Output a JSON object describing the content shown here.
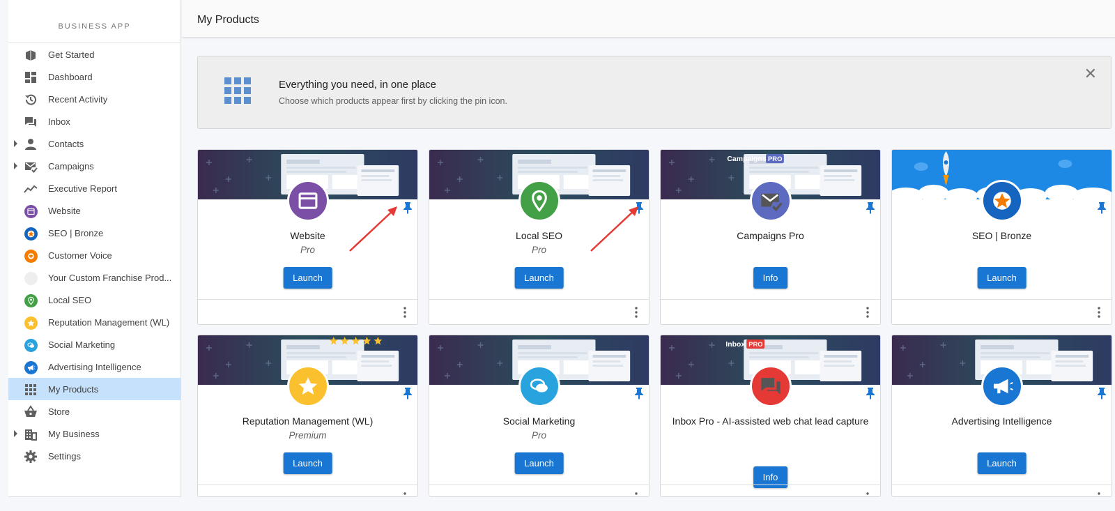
{
  "sidebar": {
    "brand": "BUSINESS APP",
    "items": [
      {
        "label": "Get Started",
        "icon": "book-hand-icon",
        "expandable": false
      },
      {
        "label": "Dashboard",
        "icon": "dashboard-icon",
        "expandable": false
      },
      {
        "label": "Recent Activity",
        "icon": "history-icon",
        "expandable": false
      },
      {
        "label": "Inbox",
        "icon": "chat-icon",
        "expandable": false
      },
      {
        "label": "Contacts",
        "icon": "person-icon",
        "expandable": true
      },
      {
        "label": "Campaigns",
        "icon": "mail-check-icon",
        "expandable": true
      },
      {
        "label": "Executive Report",
        "icon": "trend-icon",
        "expandable": false
      },
      {
        "label": "Website",
        "icon": "website-product-icon",
        "expandable": false
      },
      {
        "label": "SEO | Bronze",
        "icon": "seo-star-icon",
        "expandable": false
      },
      {
        "label": "Customer Voice",
        "icon": "customer-voice-icon",
        "expandable": false
      },
      {
        "label": "Your Custom Franchise Prod...",
        "icon": "blank-product-icon",
        "expandable": false
      },
      {
        "label": "Local SEO",
        "icon": "map-pin-product-icon",
        "expandable": false
      },
      {
        "label": "Reputation Management (WL)",
        "icon": "star-product-icon",
        "expandable": false
      },
      {
        "label": "Social Marketing",
        "icon": "speech-bubble-product-icon",
        "expandable": false
      },
      {
        "label": "Advertising Intelligence",
        "icon": "megaphone-product-icon",
        "expandable": false
      },
      {
        "label": "My Products",
        "icon": "apps-grid-icon",
        "expandable": false,
        "active": true
      },
      {
        "label": "Store",
        "icon": "basket-icon",
        "expandable": false
      },
      {
        "label": "My Business",
        "icon": "building-icon",
        "expandable": true
      },
      {
        "label": "Settings",
        "icon": "gear-icon",
        "expandable": false
      }
    ]
  },
  "header": {
    "title": "My Products"
  },
  "banner": {
    "title": "Everything you need, in one place",
    "subtitle": "Choose which products appear first by clicking the pin icon.",
    "icon": "apps-grid-icon",
    "close_icon": "close-icon"
  },
  "cards": [
    {
      "name": "Website",
      "edition": "Pro",
      "button": "Launch",
      "logo_color": "#7b4fa6",
      "icon": "website-product-icon",
      "header_image": "Website preview"
    },
    {
      "name": "Local SEO",
      "edition": "Pro",
      "button": "Launch",
      "logo_color": "#43a047",
      "icon": "map-pin-product-icon",
      "header_image": "Local SEO preview"
    },
    {
      "name": "Campaigns Pro",
      "edition": "",
      "button": "Info",
      "logo_color": "#5c6bc0",
      "icon": "mail-check-icon",
      "header_image": "Campaigns",
      "header_badge": "PRO"
    },
    {
      "name": "SEO | Bronze",
      "edition": "",
      "button": "Launch",
      "logo_color": "#1565c0",
      "icon": "seo-star-icon",
      "header_image": "SEO rocket"
    },
    {
      "name": "Reputation Management (WL)",
      "edition": "Premium",
      "button": "Launch",
      "logo_color": "#fbc02d",
      "icon": "star-product-icon",
      "header_image": "Reputation preview"
    },
    {
      "name": "Social Marketing",
      "edition": "Pro",
      "button": "Launch",
      "logo_color": "#29a3dd",
      "icon": "speech-bubble-product-icon",
      "header_image": "Social preview"
    },
    {
      "name": "Inbox Pro - AI-assisted web chat lead capture",
      "edition": "",
      "button": "Info",
      "logo_color": "#e53935",
      "icon": "chat-icon",
      "header_image": "Inbox",
      "header_badge": "PRO"
    },
    {
      "name": "Advertising Intelligence",
      "edition": "",
      "button": "Launch",
      "logo_color": "#1976d2",
      "icon": "megaphone-product-icon",
      "header_image": "Advertising preview"
    }
  ],
  "colors": {
    "accent": "#1976d2",
    "active_nav": "#c5e1fb",
    "annotation_arrow": "#e53935"
  }
}
